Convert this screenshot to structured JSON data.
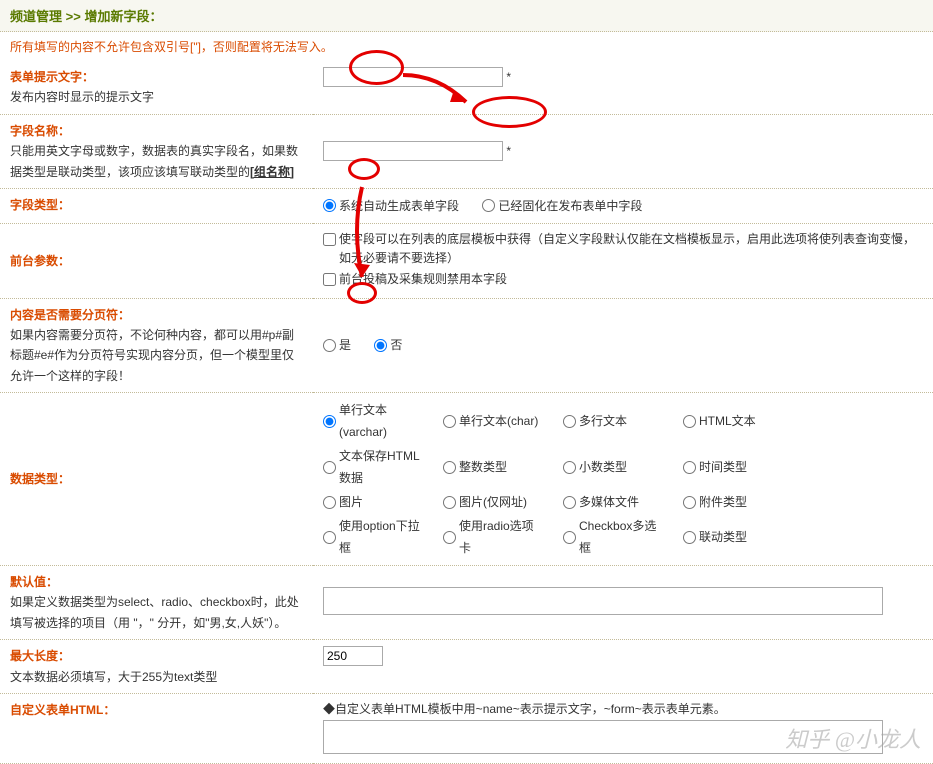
{
  "breadcrumb": {
    "section": "频道管理",
    "sep": ">>",
    "page": "增加新字段："
  },
  "warning": "所有填写的内容不允许包含双引号[\"]，否则配置将无法写入。",
  "rows": {
    "prompt": {
      "title": "表单提示文字：",
      "desc": "发布内容时显示的提示文字",
      "value": "",
      "star": "*"
    },
    "name": {
      "title": "字段名称：",
      "desc_a": "只能用英文字母或数字，数据表的真实字段名，如果数据类型是联动类型，该项应该填写联动类型的",
      "desc_b": "[组名称]",
      "value": "",
      "star": "*"
    },
    "ftype": {
      "title": "字段类型：",
      "opt1": "系统自动生成表单字段",
      "opt2": "已经固化在发布表单中字段"
    },
    "front": {
      "title": "前台参数：",
      "cb1": "使字段可以在列表的底层模板中获得（自定义字段默认仅能在文档模板显示，启用此选项将使列表查询变慢，如无必要请不要选择）",
      "cb2": "前台投稿及采集规则禁用本字段"
    },
    "page": {
      "title": "内容是否需要分页符：",
      "desc": "如果内容需要分页符，不论何种内容，都可以用#p#副标题#e#作为分页符号实现内容分页，但一个模型里仅允许一个这样的字段！",
      "opt_yes": "是",
      "opt_no": "否"
    },
    "dtype": {
      "title": "数据类型：",
      "opts": [
        "单行文本 (varchar)",
        "单行文本(char)",
        "多行文本",
        "HTML文本",
        "",
        "文本保存HTML数据",
        "整数类型",
        "小数类型",
        "时间类型",
        "",
        "图片",
        "图片(仅网址)",
        "多媒体文件",
        "附件类型",
        "",
        "使用option下拉框",
        "使用radio选项卡",
        "Checkbox多选框",
        "联动类型",
        ""
      ]
    },
    "default": {
      "title": "默认值：",
      "desc": "如果定义数据类型为select、radio、checkbox时，此处填写被选择的项目（用 \"，\" 分开，如\"男,女,人妖\"）。",
      "value": ""
    },
    "maxlen": {
      "title": "最大长度：",
      "desc": "文本数据必须填写，大于255为text类型",
      "value": "250"
    },
    "customhtml": {
      "title": "自定义表单HTML：",
      "hint": "自定义表单HTML模板中用~name~表示提示文字，~form~表示表单元素。",
      "value": ""
    }
  },
  "watermark": "知乎 @小龙人"
}
